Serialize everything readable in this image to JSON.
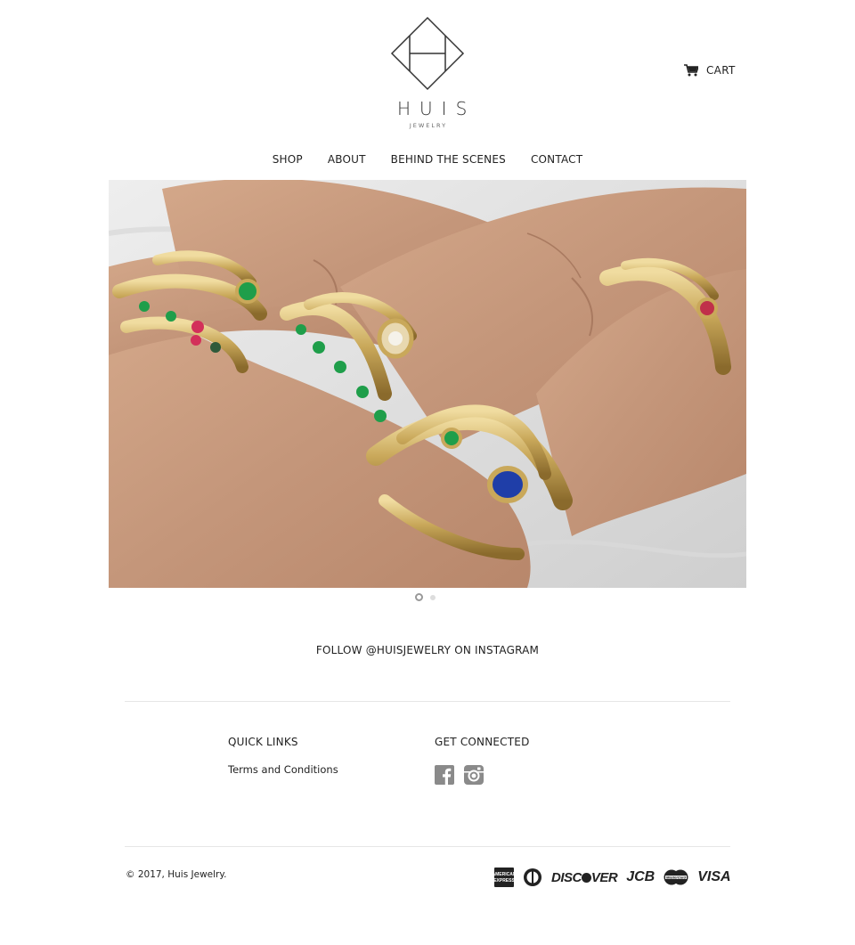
{
  "header": {
    "logo_word": "HUIS",
    "logo_sub": "JEWELRY",
    "cart_label": "CART"
  },
  "nav": {
    "items": [
      {
        "label": "SHOP"
      },
      {
        "label": "ABOUT"
      },
      {
        "label": "BEHIND THE SCENES"
      },
      {
        "label": "CONTACT"
      }
    ]
  },
  "slideshow": {
    "slide_count": 2,
    "active_slide": 1
  },
  "instagram": {
    "follow_text": "FOLLOW @HUISJEWELRY ON INSTAGRAM"
  },
  "footer": {
    "quick_links_heading": "QUICK LINKS",
    "quick_links": [
      {
        "label": "Terms and Conditions"
      }
    ],
    "connected_heading": "GET CONNECTED",
    "social_icons": [
      "facebook-icon",
      "instagram-icon"
    ],
    "copyright": "© 2017, Huis Jewelry.",
    "payment_methods": [
      "AMERICAN EXPRESS",
      "DINERS CLUB",
      "DISCOVER",
      "JCB",
      "MasterCard",
      "VISA"
    ]
  },
  "colors": {
    "text": "#222222",
    "divider": "#e6e6e6",
    "social_icon": "#8a8a8a",
    "skin": "#c79a7c",
    "gold": "#c9a85a",
    "emerald": "#1f9e4a",
    "sapphire": "#1f3ea8",
    "ruby": "#d3305a"
  }
}
